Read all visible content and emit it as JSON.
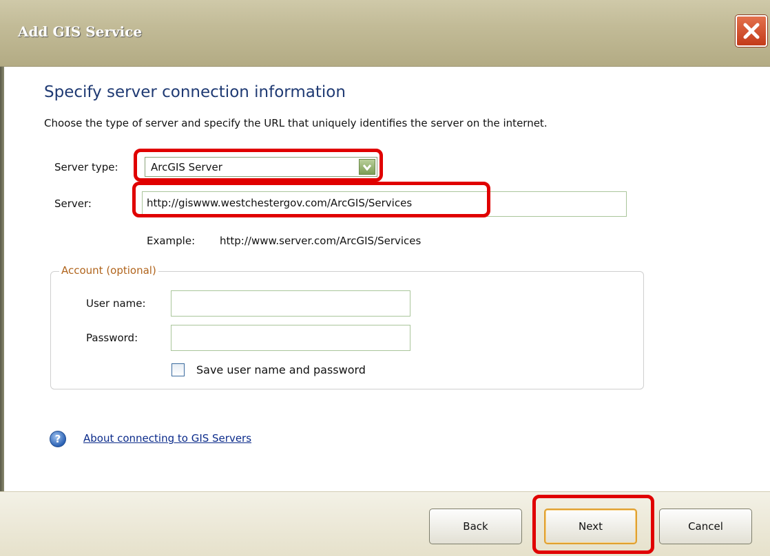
{
  "window": {
    "title": "Add GIS Service"
  },
  "content": {
    "heading": "Specify server connection information",
    "description": "Choose the type of server and specify the URL that uniquely identifies the server on the internet."
  },
  "server_type": {
    "label": "Server type:",
    "selected": "ArcGIS Server"
  },
  "server": {
    "label": "Server:",
    "value": "http://giswww.westchestergov.com/ArcGIS/Services",
    "example_label": "Example:",
    "example_value": "http://www.server.com/ArcGIS/Services"
  },
  "account": {
    "title": "Account (optional)",
    "username_label": "User name:",
    "username_value": "",
    "password_label": "Password:",
    "password_value": "",
    "save_label": "Save user name and password",
    "save_checked": false
  },
  "help": {
    "link": "About connecting to GIS Servers"
  },
  "footer": {
    "back": "Back",
    "next": "Next",
    "cancel": "Cancel"
  },
  "icons": {
    "close": "close-icon",
    "dropdown": "chevron-down-icon",
    "help": "help-icon",
    "checkbox": "checkbox-icon"
  },
  "colors": {
    "highlight": "#e00000",
    "heading": "#1f3a73",
    "link": "#0a2a8a",
    "group_title": "#b0641c"
  }
}
